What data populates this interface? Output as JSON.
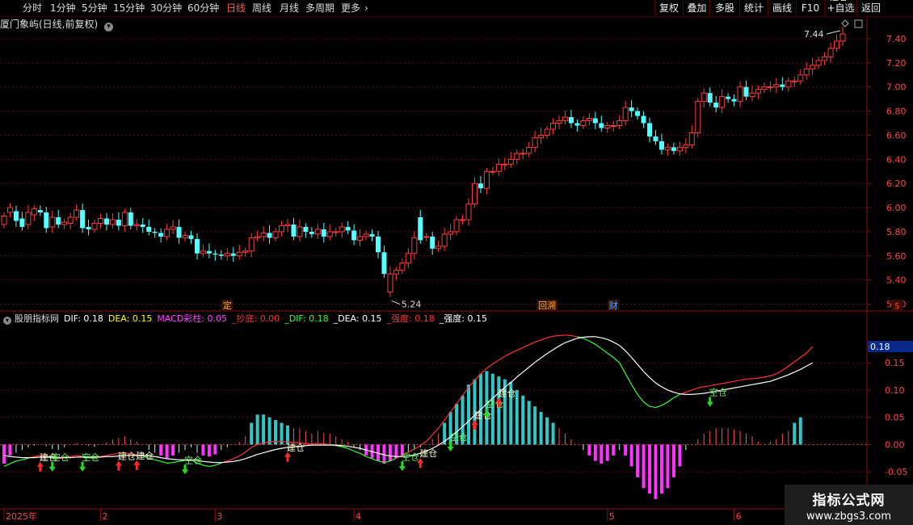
{
  "toolbar": {
    "periods": [
      "分时",
      "1分钟",
      "5分钟",
      "15分钟",
      "30分钟",
      "60分钟",
      "日线",
      "周线",
      "月线",
      "多周期",
      "更多"
    ],
    "active_period": "日线",
    "more_arrow": "›",
    "buttons": [
      "复权",
      "叠加",
      "多股",
      "统计",
      "画线",
      "F10",
      "+自选",
      "返回"
    ]
  },
  "title": {
    "stock": "厦门象屿(日线,前复权)",
    "chevron_icon": "chevron-down-icon",
    "panel_icon": "panel-icon",
    "diamond_icon": "diamond-icon"
  },
  "indicator": {
    "name": "股朋指标网",
    "items": [
      {
        "label": "DIF: 0.18",
        "color": "#ffffff"
      },
      {
        "label": "DEA: 0.15",
        "color": "#ffff00"
      },
      {
        "label": "MACD彩柱: 0.05",
        "color": "#ff44ff"
      },
      {
        "label": "_抄底: 0.00",
        "color": "#ff3333"
      },
      {
        "label": "_DIF: 0.18",
        "color": "#33ff33"
      },
      {
        "label": "_DEA: 0.15",
        "color": "#ffffff"
      },
      {
        "label": "_强度: 0.18",
        "color": "#ff3333"
      },
      {
        "label": "_强度: 0.15",
        "color": "#ffffff"
      }
    ]
  },
  "watermark": {
    "line1": "指标公式网",
    "line2": "www.zbgs3.com"
  },
  "chart_data": [
    {
      "type": "candlestick",
      "name": "price",
      "ylim": [
        5.15,
        7.48
      ],
      "yticks": [
        "7.40",
        "7.20",
        "7.00",
        "6.80",
        "6.60",
        "6.40",
        "6.20",
        "6.00",
        "5.80",
        "5.60",
        "5.40",
        "5.20"
      ],
      "annotations": {
        "high": "7.44",
        "low": "5.24"
      },
      "event_markers": [
        {
          "label": "定",
          "index": 37,
          "color": "#ffaa33"
        },
        {
          "label": "回溯",
          "index": 90,
          "color": "#ffaa33"
        },
        {
          "label": "财",
          "index": 101,
          "color": "#55aaff"
        },
        {
          "label": "$",
          "index": 148,
          "color": "#ff3333"
        }
      ],
      "closes": [
        5.93,
        6.0,
        5.89,
        5.84,
        5.96,
        5.99,
        5.96,
        5.83,
        5.92,
        5.86,
        5.88,
        5.92,
        5.98,
        5.83,
        5.82,
        5.87,
        5.91,
        5.86,
        5.9,
        5.85,
        5.96,
        5.85,
        5.86,
        5.84,
        5.8,
        5.79,
        5.76,
        5.82,
        5.84,
        5.75,
        5.77,
        5.74,
        5.62,
        5.64,
        5.62,
        5.61,
        5.6,
        5.62,
        5.6,
        5.63,
        5.64,
        5.75,
        5.76,
        5.79,
        5.75,
        5.8,
        5.85,
        5.86,
        5.76,
        5.84,
        5.8,
        5.78,
        5.82,
        5.76,
        5.8,
        5.8,
        5.84,
        5.81,
        5.73,
        5.76,
        5.78,
        5.76,
        5.63,
        5.45,
        5.45,
        5.48,
        5.54,
        5.62,
        5.75,
        5.73,
        5.76,
        5.66,
        5.68,
        5.78,
        5.8,
        5.9,
        5.9,
        6.03,
        6.2,
        6.16,
        6.3,
        6.3,
        6.36,
        6.36,
        6.4,
        6.45,
        6.45,
        6.5,
        6.58,
        6.6,
        6.65,
        6.7,
        6.72,
        6.75,
        6.7,
        6.68,
        6.72,
        6.74,
        6.7,
        6.66,
        6.68,
        6.68,
        6.72,
        6.83,
        6.8,
        6.76,
        6.7,
        6.59,
        6.55,
        6.48,
        6.5,
        6.47,
        6.5,
        6.52,
        6.62,
        6.88,
        6.95,
        6.87,
        6.83,
        6.92,
        6.9,
        6.88,
        7.0,
        6.92,
        6.95,
        6.98,
        7.0,
        7.0,
        7.02,
        7.0,
        7.05,
        7.05,
        7.1,
        7.15,
        7.18,
        7.22,
        7.25,
        7.32,
        7.38,
        7.44
      ],
      "opens": [
        5.86,
        5.96,
        5.97,
        5.91,
        5.86,
        5.94,
        5.98,
        5.96,
        5.84,
        5.92,
        5.86,
        5.87,
        5.92,
        5.98,
        5.84,
        5.82,
        5.87,
        5.91,
        5.86,
        5.9,
        5.85,
        5.96,
        5.85,
        5.86,
        5.84,
        5.8,
        5.79,
        5.76,
        5.82,
        5.84,
        5.75,
        5.77,
        5.74,
        5.62,
        5.64,
        5.62,
        5.61,
        5.6,
        5.62,
        5.6,
        5.63,
        5.64,
        5.75,
        5.76,
        5.79,
        5.75,
        5.8,
        5.85,
        5.86,
        5.76,
        5.84,
        5.8,
        5.78,
        5.82,
        5.76,
        5.8,
        5.8,
        5.84,
        5.81,
        5.73,
        5.76,
        5.78,
        5.76,
        5.63,
        5.3,
        5.45,
        5.48,
        5.54,
        5.62,
        5.92,
        5.76,
        5.76,
        5.66,
        5.68,
        5.78,
        5.8,
        5.9,
        5.9,
        6.03,
        6.2,
        6.16,
        6.3,
        6.3,
        6.36,
        6.36,
        6.4,
        6.45,
        6.45,
        6.5,
        6.58,
        6.6,
        6.65,
        6.7,
        6.72,
        6.75,
        6.7,
        6.68,
        6.72,
        6.74,
        6.7,
        6.66,
        6.68,
        6.68,
        6.72,
        6.83,
        6.8,
        6.76,
        6.7,
        6.59,
        6.55,
        6.48,
        6.5,
        6.47,
        6.5,
        6.52,
        6.62,
        6.88,
        6.95,
        6.87,
        6.83,
        6.92,
        6.9,
        6.88,
        7.0,
        6.92,
        6.95,
        6.98,
        7.0,
        7.0,
        7.02,
        7.0,
        7.05,
        7.05,
        7.1,
        7.15,
        7.18,
        7.22,
        7.25,
        7.32,
        7.38
      ]
    },
    {
      "type": "macd",
      "name": "indicator",
      "ylim": [
        -0.115,
        0.22
      ],
      "yticks": [
        "0.15",
        "0.10",
        "0.05",
        "0.00",
        "-0.05"
      ],
      "current_value": "0.18",
      "x_labels": [
        {
          "label": "2025年",
          "index": 0
        },
        {
          "label": "2",
          "index": 16
        },
        {
          "label": "3",
          "index": 35
        },
        {
          "label": "4",
          "index": 58
        },
        {
          "label": "5",
          "index": 100
        },
        {
          "label": "6",
          "index": 121
        },
        {
          "label": "2025/",
          "index": 144
        }
      ],
      "hist": [
        -0.035,
        -0.02,
        -0.015,
        -0.01,
        -0.005,
        -0.002,
        0.0,
        -0.003,
        -0.008,
        -0.01,
        -0.005,
        0.0,
        0.003,
        0.0,
        -0.002,
        -0.004,
        0.0,
        0.004,
        0.01,
        0.012,
        0.015,
        0.01,
        0.005,
        0.0,
        -0.01,
        -0.015,
        -0.02,
        -0.025,
        -0.02,
        -0.015,
        -0.01,
        -0.005,
        -0.015,
        -0.02,
        -0.022,
        -0.018,
        -0.01,
        -0.005,
        0.0,
        0.005,
        0.015,
        0.04,
        0.055,
        0.055,
        0.05,
        0.045,
        0.04,
        0.035,
        0.03,
        0.03,
        0.025,
        0.02,
        0.025,
        0.022,
        0.02,
        0.015,
        0.01,
        0.005,
        -0.005,
        -0.01,
        -0.02,
        -0.025,
        -0.03,
        -0.035,
        -0.03,
        -0.025,
        -0.02,
        -0.015,
        -0.01,
        -0.005,
        0.0,
        0.01,
        0.02,
        0.04,
        0.06,
        0.075,
        0.09,
        0.11,
        0.12,
        0.13,
        0.135,
        0.13,
        0.125,
        0.12,
        0.115,
        0.1,
        0.09,
        0.08,
        0.07,
        0.06,
        0.05,
        0.04,
        0.03,
        0.02,
        0.01,
        0.0,
        -0.01,
        -0.02,
        -0.03,
        -0.035,
        -0.03,
        -0.02,
        -0.01,
        -0.02,
        -0.04,
        -0.06,
        -0.08,
        -0.09,
        -0.1,
        -0.09,
        -0.08,
        -0.06,
        -0.04,
        -0.01,
        0.0,
        0.01,
        0.02,
        0.025,
        0.03,
        0.03,
        0.03,
        0.028,
        0.025,
        0.02,
        0.015,
        0.005,
        0.0,
        0.005,
        0.01,
        0.02,
        0.025,
        0.04,
        0.05
      ],
      "dif": [
        -0.04,
        -0.035,
        -0.03,
        -0.028,
        -0.025,
        -0.022,
        -0.02,
        -0.022,
        -0.025,
        -0.026,
        -0.024,
        -0.022,
        -0.02,
        -0.022,
        -0.024,
        -0.025,
        -0.022,
        -0.02,
        -0.018,
        -0.016,
        -0.015,
        -0.017,
        -0.019,
        -0.021,
        -0.025,
        -0.028,
        -0.031,
        -0.034,
        -0.033,
        -0.031,
        -0.029,
        -0.028,
        -0.034,
        -0.038,
        -0.04,
        -0.038,
        -0.034,
        -0.03,
        -0.026,
        -0.021,
        -0.014,
        -0.005,
        0.0,
        0.003,
        0.005,
        0.006,
        0.006,
        0.005,
        0.004,
        0.003,
        0.002,
        0.001,
        0.002,
        0.001,
        0.0,
        -0.002,
        -0.004,
        -0.007,
        -0.012,
        -0.016,
        -0.022,
        -0.026,
        -0.03,
        -0.033,
        -0.03,
        -0.025,
        -0.02,
        -0.014,
        -0.008,
        -0.002,
        0.006,
        0.018,
        0.03,
        0.045,
        0.06,
        0.075,
        0.09,
        0.105,
        0.118,
        0.13,
        0.14,
        0.148,
        0.155,
        0.162,
        0.168,
        0.173,
        0.178,
        0.183,
        0.188,
        0.192,
        0.196,
        0.199,
        0.2,
        0.201,
        0.2,
        0.198,
        0.195,
        0.19,
        0.184,
        0.176,
        0.168,
        0.16,
        0.15,
        0.13,
        0.11,
        0.092,
        0.078,
        0.07,
        0.068,
        0.072,
        0.078,
        0.086,
        0.092,
        0.096,
        0.1,
        0.104,
        0.106,
        0.108,
        0.11,
        0.112,
        0.114,
        0.116,
        0.118,
        0.12,
        0.121,
        0.122,
        0.124,
        0.126,
        0.13,
        0.136,
        0.144,
        0.152,
        0.16,
        0.168,
        0.18
      ],
      "dea": [
        -0.02,
        -0.022,
        -0.023,
        -0.024,
        -0.024,
        -0.024,
        -0.023,
        -0.023,
        -0.023,
        -0.024,
        -0.024,
        -0.024,
        -0.023,
        -0.023,
        -0.023,
        -0.023,
        -0.023,
        -0.022,
        -0.022,
        -0.021,
        -0.02,
        -0.02,
        -0.02,
        -0.02,
        -0.021,
        -0.022,
        -0.024,
        -0.026,
        -0.027,
        -0.028,
        -0.028,
        -0.028,
        -0.029,
        -0.031,
        -0.032,
        -0.033,
        -0.033,
        -0.032,
        -0.031,
        -0.029,
        -0.026,
        -0.022,
        -0.018,
        -0.015,
        -0.012,
        -0.009,
        -0.007,
        -0.005,
        -0.004,
        -0.003,
        -0.002,
        -0.001,
        -0.001,
        -0.001,
        -0.001,
        -0.001,
        -0.002,
        -0.003,
        -0.005,
        -0.007,
        -0.01,
        -0.013,
        -0.016,
        -0.019,
        -0.021,
        -0.022,
        -0.022,
        -0.021,
        -0.019,
        -0.016,
        -0.012,
        -0.007,
        -0.001,
        0.006,
        0.014,
        0.023,
        0.033,
        0.043,
        0.054,
        0.064,
        0.075,
        0.085,
        0.095,
        0.105,
        0.114,
        0.124,
        0.133,
        0.142,
        0.151,
        0.159,
        0.167,
        0.174,
        0.181,
        0.187,
        0.191,
        0.195,
        0.197,
        0.198,
        0.198,
        0.196,
        0.193,
        0.188,
        0.182,
        0.172,
        0.16,
        0.147,
        0.134,
        0.123,
        0.113,
        0.106,
        0.1,
        0.096,
        0.093,
        0.092,
        0.092,
        0.093,
        0.094,
        0.096,
        0.098,
        0.1,
        0.102,
        0.104,
        0.106,
        0.108,
        0.11,
        0.112,
        0.114,
        0.116,
        0.12,
        0.124,
        0.128,
        0.133,
        0.138,
        0.144,
        0.15
      ],
      "signals": [
        {
          "index": 6,
          "label": "建仓",
          "dir": "up"
        },
        {
          "index": 8,
          "label": "空仓",
          "dir": "down"
        },
        {
          "index": 13,
          "label": "空仓",
          "dir": "down"
        },
        {
          "index": 19,
          "label": "建仓",
          "dir": "up"
        },
        {
          "index": 22,
          "label": "建仓",
          "dir": "up"
        },
        {
          "index": 30,
          "label": "空仓",
          "dir": "down"
        },
        {
          "index": 47,
          "label": "建仓",
          "dir": "up"
        },
        {
          "index": 66,
          "label": "空仓",
          "dir": "down"
        },
        {
          "index": 69,
          "label": "建仓",
          "dir": "up"
        },
        {
          "index": 74,
          "label": "空仓",
          "dir": "down"
        },
        {
          "index": 78,
          "label": "建仓",
          "dir": "up"
        },
        {
          "index": 80,
          "label": "空仓",
          "dir": "down"
        },
        {
          "index": 82,
          "label": "建仓",
          "dir": "up"
        },
        {
          "index": 117,
          "label": "空仓",
          "dir": "down"
        },
        {
          "index": 137,
          "label": "建仓",
          "dir": "up"
        }
      ]
    }
  ]
}
